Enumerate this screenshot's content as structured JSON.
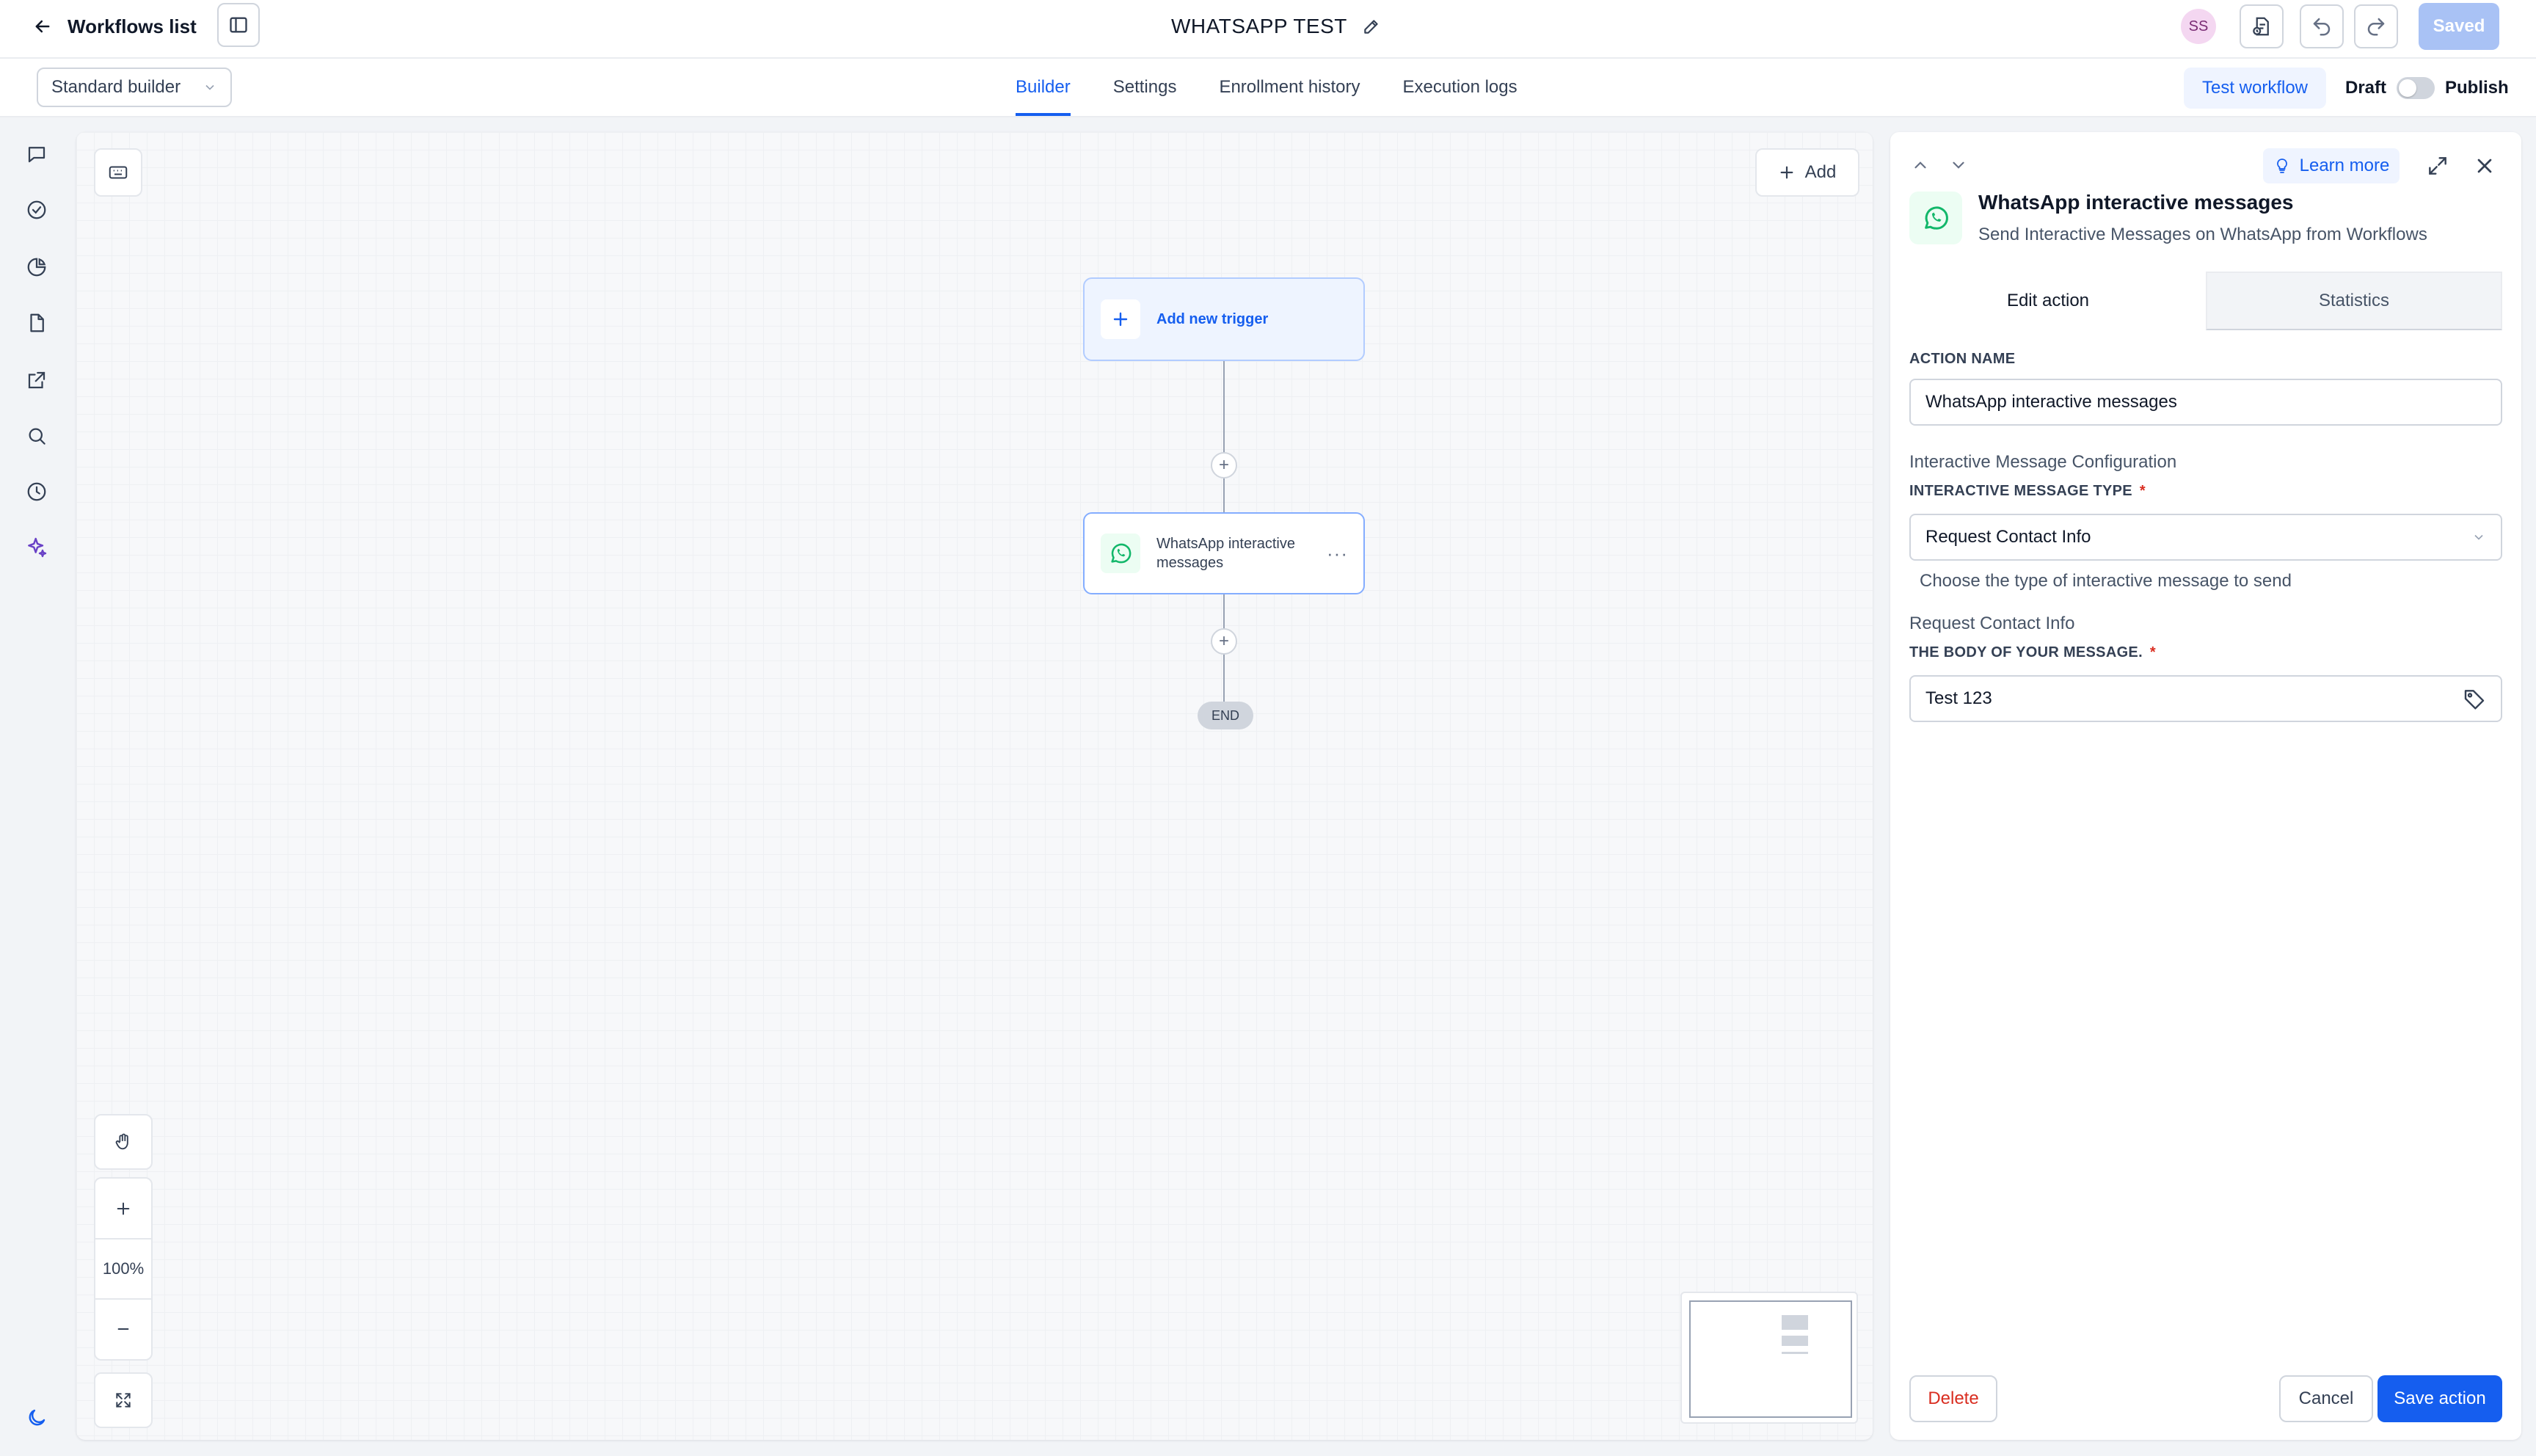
{
  "header": {
    "back_label": "Workflows list",
    "workflow_title": "WHATSAPP TEST",
    "avatar_initials": "SS",
    "saved_label": "Saved"
  },
  "subheader": {
    "builder_mode": "Standard builder",
    "tabs": [
      {
        "label": "Builder",
        "active": true
      },
      {
        "label": "Settings",
        "active": false
      },
      {
        "label": "Enrollment history",
        "active": false
      },
      {
        "label": "Execution logs",
        "active": false
      }
    ],
    "test_workflow_label": "Test workflow",
    "draft_label": "Draft",
    "publish_label": "Publish",
    "published": false
  },
  "rail": {
    "icons": [
      "chat-icon",
      "check-circle-icon",
      "pie-chart-icon",
      "file-icon",
      "external-link-icon",
      "search-icon",
      "clock-icon",
      "sparkle-icon",
      "moon-icon"
    ]
  },
  "canvas": {
    "add_label": "Add",
    "trigger_label": "Add new trigger",
    "action_label": "WhatsApp interactive messages",
    "end_label": "END",
    "zoom": "100%"
  },
  "panel": {
    "learn_more_label": "Learn more",
    "title": "WhatsApp interactive messages",
    "description": "Send Interactive Messages on WhatsApp from Workflows",
    "tab_edit": "Edit action",
    "tab_stats": "Statistics",
    "action_name_label": "ACTION NAME",
    "action_name_value": "WhatsApp interactive messages",
    "config_section": "Interactive Message Configuration",
    "message_type_label": "INTERACTIVE MESSAGE TYPE",
    "message_type_value": "Request Contact Info",
    "message_type_hint": "Choose the type of interactive message to send",
    "contact_section": "Request Contact Info",
    "body_label": "THE BODY OF YOUR MESSAGE.",
    "body_value": "Test 123",
    "required_mark": "*",
    "delete_label": "Delete",
    "cancel_label": "Cancel",
    "save_label": "Save action"
  },
  "colors": {
    "accent": "#155eef",
    "danger": "#d92d20",
    "whatsapp": "#12b76a"
  }
}
